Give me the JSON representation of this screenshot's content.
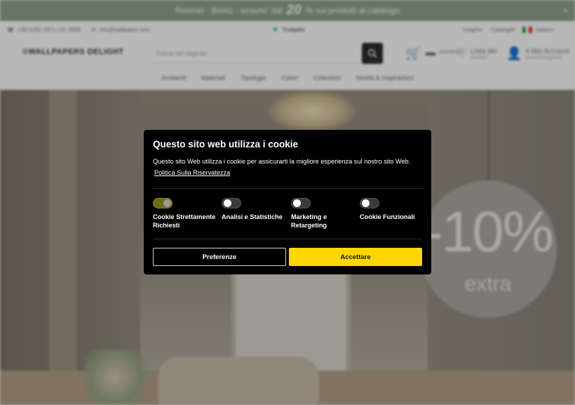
{
  "promo": {
    "text_before": "Rimmel · Beetz · scouns' dal",
    "big": "20",
    "text_after": "% sui prodotti al catalogo",
    "close": "×"
  },
  "topline": {
    "phone": "+39 0(35) 0371 / 01 0058",
    "email": "info@wallpaper.com",
    "trustpilot": "Trustpilot",
    "link1": "Insights",
    "link2": "Cataloghi",
    "language": "Italiano"
  },
  "header": {
    "logo": "©WALLPAPERS DELIGHT",
    "search_placeholder": "Cerca nel negozio",
    "cart_label": "",
    "chat_label": "Assistenza",
    "fav_label": "Lista dei",
    "fav_sub": "desideri",
    "account_label": "Il Mio Account",
    "account_sub": "Accedi/Registrati"
  },
  "nav": [
    "Ambienti",
    "Materiali",
    "Tipologie",
    "Colori",
    "Collezioni",
    "Novità & Inspirazioni"
  ],
  "hero": {
    "tag_percent": "-10%",
    "tag_extra": "extra"
  },
  "cookie": {
    "title": "Questo sito web utilizza i cookie",
    "description": "Questo sito Web utilizza i cookie per assicurarti la migliore esperienza sul nostro sito Web.",
    "policy_link": "Politica Sulla Riservatezza",
    "options": [
      {
        "label": "Cookie Strettamente Richiesti",
        "enabled": true
      },
      {
        "label": "Analisi e Statistiche",
        "enabled": false
      },
      {
        "label": "Marketing e Retargeting",
        "enabled": false
      },
      {
        "label": "Cookie Funzionali",
        "enabled": false
      }
    ],
    "preferences_button": "Preferenze",
    "accept_button": "Accettare"
  },
  "colors": {
    "promo_bar": "#8fa38c",
    "accept_button": "#ffd600",
    "dialog_background": "#000000"
  }
}
